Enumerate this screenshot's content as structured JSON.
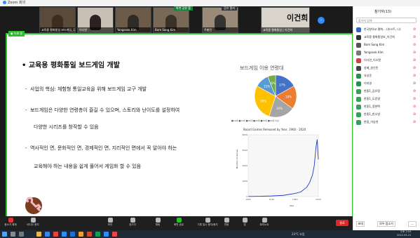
{
  "window": {
    "title": "Zoom 회의"
  },
  "thumbnails": [
    {
      "name": "교육용 평화통일 보드게임_김영민"
    },
    {
      "name": "이다연"
    },
    {
      "name": "Yangseok Kim"
    },
    {
      "name": "Bom Sang Kim"
    },
    {
      "name": "주충민"
    },
    {
      "name": "교육용 평화통일 | 이건희"
    }
  ],
  "big_name": "이건희",
  "banners": {
    "share_label": "화면 공유 중",
    "stop_share": "공유 중지",
    "recording": "녹화 중"
  },
  "share_toolbar": {
    "label": "● 녹화 중"
  },
  "slide": {
    "title": "교육용 평화통일 보드게임 개발",
    "bullets": [
      "사업의 핵심: 체험형 통일교육을 위해 보드게임 교구 개발",
      "보드게임은 다양한 연령층이 즐길 수 있으며, 스토리와 난이도를 설정하여",
      "다양한 시리즈를 창작할 수 있음",
      "역사적인 면, 문화적인 면, 경제적인 면, 지리적인 면에서 꼭 알아야 하는",
      "교육해야 하는 내용을 쉽게 풀어서 게임화 할 수 있음"
    ],
    "pie_title": "보드게임 이용 연령대",
    "pie_legend": "■10대 ■20대 ■30대 ■40대 ■50대 ■60대 이상",
    "line_title": "Board Games Released by Year, 1900 - 2020",
    "line_xlabel": "Year",
    "line_ylabel": "Number of Games"
  },
  "chart_data": [
    {
      "type": "pie",
      "title": "보드게임 이용 연령대",
      "categories": [
        "10대",
        "20대",
        "30대",
        "40대",
        "50대",
        "60대 이상"
      ],
      "values": [
        17,
        18,
        20,
        28,
        11,
        6
      ],
      "colors": [
        "#4472c4",
        "#ed7d31",
        "#a5a5a5",
        "#ffc000",
        "#5b9bd5",
        "#70ad47"
      ]
    },
    {
      "type": "line",
      "title": "Board Games Released by Year, 1900 - 2020",
      "xlabel": "Year",
      "ylabel": "Number of Games",
      "x": [
        1900,
        1920,
        1940,
        1960,
        1980,
        1990,
        2000,
        2005,
        2010,
        2013,
        2016,
        2018,
        2020
      ],
      "y": [
        10,
        20,
        40,
        80,
        200,
        300,
        600,
        900,
        1400,
        2000,
        3200,
        3700,
        2400
      ],
      "xlim": [
        1900,
        2020
      ],
      "ylim": [
        0,
        4000
      ]
    }
  ],
  "toolbar": {
    "items": [
      {
        "label": "음소거 해제"
      },
      {
        "label": "비디오 중지"
      },
      {
        "label": "보안"
      },
      {
        "label": "참가자"
      },
      {
        "label": "채팅"
      },
      {
        "label": "화면 공유"
      },
      {
        "label": "기록 일시 중지/중지"
      },
      {
        "label": "반응"
      },
      {
        "label": "앱"
      },
      {
        "label": "회의노트"
      }
    ],
    "end_label": "종료"
  },
  "panel": {
    "title": "참가자(13)",
    "search_placeholder": "참가자 검색",
    "participants": [
      {
        "name": "한국창의교 평화... (호스트, 나)",
        "color": "#3366cc"
      },
      {
        "name": "교육용 평화통일보_이건희",
        "color": "#333333"
      },
      {
        "name": "Bom Sang Kim",
        "color": "#555555"
      },
      {
        "name": "Yangseok Kim",
        "color": "#777777"
      },
      {
        "name": "이다연_이스탠",
        "color": "#cc4444"
      },
      {
        "name": "송혜_송인민",
        "color": "#444444"
      },
      {
        "name": "유성준",
        "color": "#2e8b57"
      },
      {
        "name": "이지영",
        "color": "#2e8b57"
      },
      {
        "name": "한중1_김유정",
        "color": "#3a9d5d"
      },
      {
        "name": "한중1_도준영",
        "color": "#3a9d5d"
      },
      {
        "name": "한중1_정현택",
        "color": "#3a9d5d"
      },
      {
        "name": "한중1_한소영",
        "color": "#3a9d5d"
      },
      {
        "name": "한림_이승연",
        "color": "#3a9d5d"
      }
    ],
    "invite_label": "초대",
    "mute_all_label": "모두 음소거",
    "more_label": "..."
  },
  "taskbar": {
    "weather": "23°C 흐림",
    "time": "오후 2:04",
    "date": "2022-05-21"
  }
}
